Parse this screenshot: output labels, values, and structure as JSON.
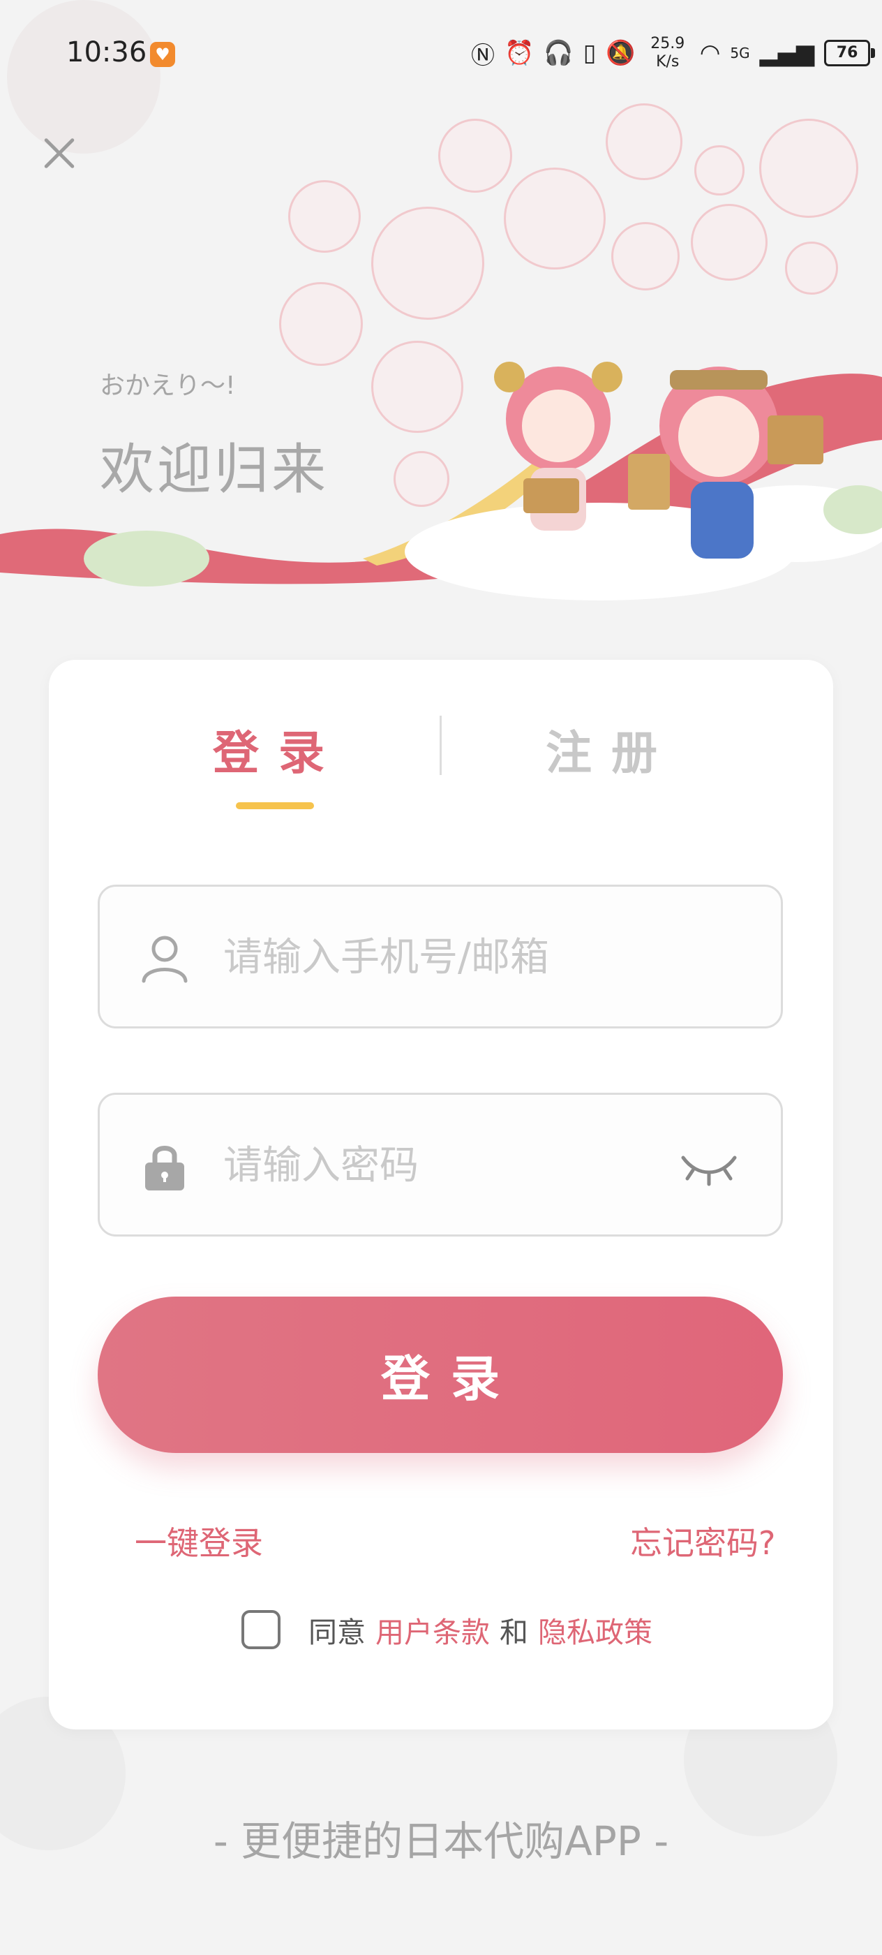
{
  "status_bar": {
    "time": "10:36",
    "net_speed_value": "25.9",
    "net_speed_unit": "K/s",
    "network_label": "5G",
    "battery": "76"
  },
  "welcome": {
    "greeting_jp": "おかえり～!",
    "greeting_cn": "欢迎归来"
  },
  "tabs": {
    "login": "登录",
    "register": "注册"
  },
  "form": {
    "phone_placeholder": "请输入手机号/邮箱",
    "password_placeholder": "请输入密码",
    "submit_label": "登录"
  },
  "links": {
    "one_key_login": "一键登录",
    "forgot_password": "忘记密码?"
  },
  "agreement": {
    "prefix": "同意",
    "terms": "用户条款",
    "and": "和",
    "privacy": "隐私政策"
  },
  "slogan": "- 更便捷的日本代购APP -",
  "colors": {
    "accent": "#de6675",
    "tab_underline": "#f6c34d",
    "background": "#f3f3f3"
  },
  "icons": [
    "close-icon",
    "user-icon",
    "lock-icon",
    "eye-closed-icon",
    "checkbox-icon"
  ]
}
